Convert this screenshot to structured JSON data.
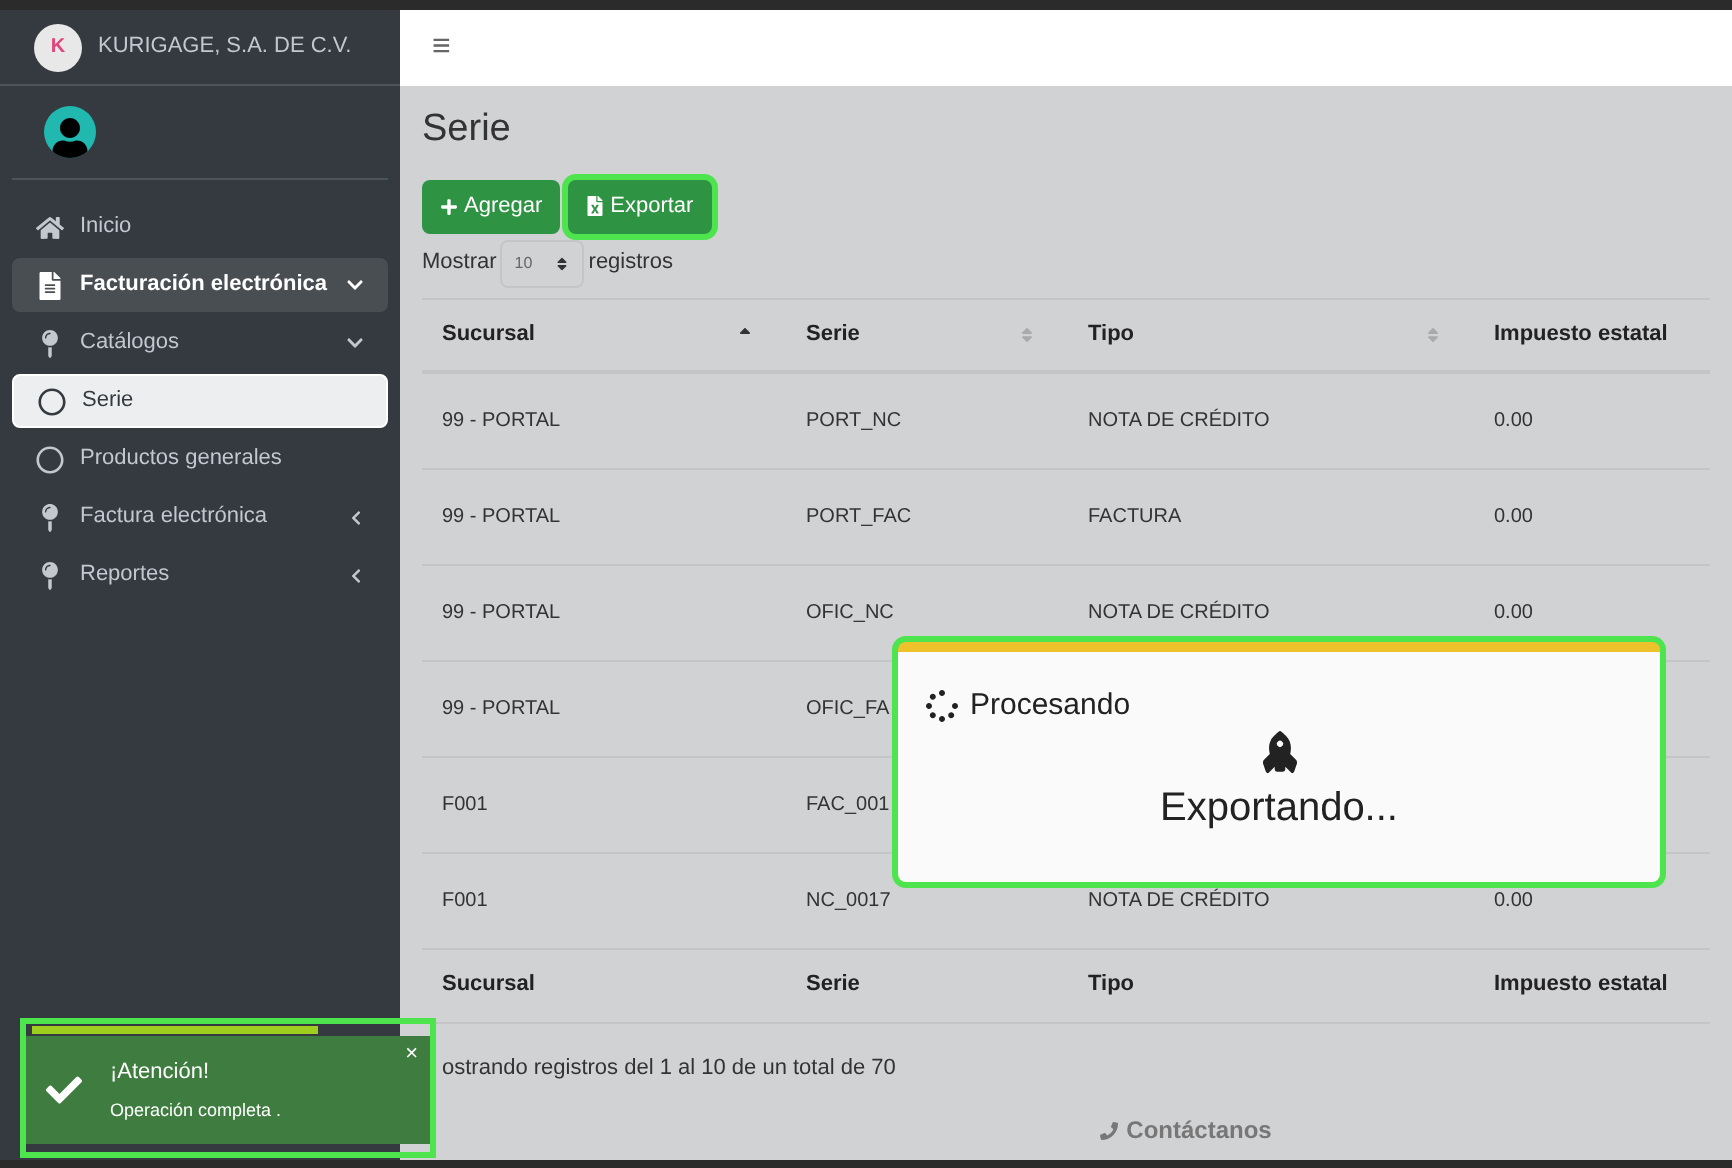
{
  "sidebar": {
    "brand": "KURIGAGE, S.A. DE C.V.",
    "logo_letter": "K",
    "items": [
      {
        "label": "Inicio",
        "selected": false
      },
      {
        "label": "Facturación electrónica",
        "selected": true,
        "expanded": true,
        "children": [
          {
            "label": "Catálogos",
            "selected": false,
            "expanded": true,
            "children": [
              {
                "label": "Serie",
                "selected": true
              },
              {
                "label": "Productos generales",
                "selected": false
              }
            ]
          },
          {
            "label": "Factura electrónica",
            "selected": false,
            "expanded": false
          },
          {
            "label": "Reportes",
            "selected": false,
            "expanded": false
          }
        ]
      }
    ]
  },
  "header": {
    "menu_icon": "≡"
  },
  "page": {
    "title": "Serie",
    "buttons": [
      {
        "label": "Agregar",
        "kind": "add",
        "highlighted": false
      },
      {
        "label": "Exportar",
        "kind": "export",
        "highlighted": true
      }
    ],
    "length": {
      "before": "Mostrar",
      "value": "10",
      "after": "registros"
    },
    "table": {
      "columns": [
        {
          "label": "Sucursal",
          "sorted": true
        },
        {
          "label": "Serie",
          "sorted": false
        },
        {
          "label": "Tipo",
          "sorted": false
        },
        {
          "label": "Impuesto estatal"
        }
      ],
      "rows": [
        [
          "99 - PORTAL",
          "PORT_NC",
          "NOTA DE CRÉDITO",
          "0.00"
        ],
        [
          "99 - PORTAL",
          "PORT_FAC",
          "FACTURA",
          "0.00"
        ],
        [
          "99 - PORTAL",
          "OFIC_NC",
          "NOTA DE CRÉDITO",
          "0.00"
        ],
        [
          "99 - PORTAL",
          "OFIC_FA",
          null,
          null
        ],
        [
          "F001",
          "FAC_001",
          null,
          null
        ],
        [
          "F001",
          "NC_0017",
          "NOTA DE CRÉDITO",
          "0.00"
        ]
      ],
      "footer": [
        "Sucursal",
        "Serie",
        "Tipo",
        "Impuesto estatal"
      ]
    },
    "info": "ostrando registros del 1 al 10 de un total de 70",
    "contact": "Contáctanos"
  },
  "processing": {
    "label": "Procesando",
    "message": "Exportando...",
    "highlighted": true
  },
  "toast": {
    "title": "¡Atención!",
    "message": "Operación completa .",
    "close": "×",
    "level": 0.75,
    "highlighted": true
  }
}
